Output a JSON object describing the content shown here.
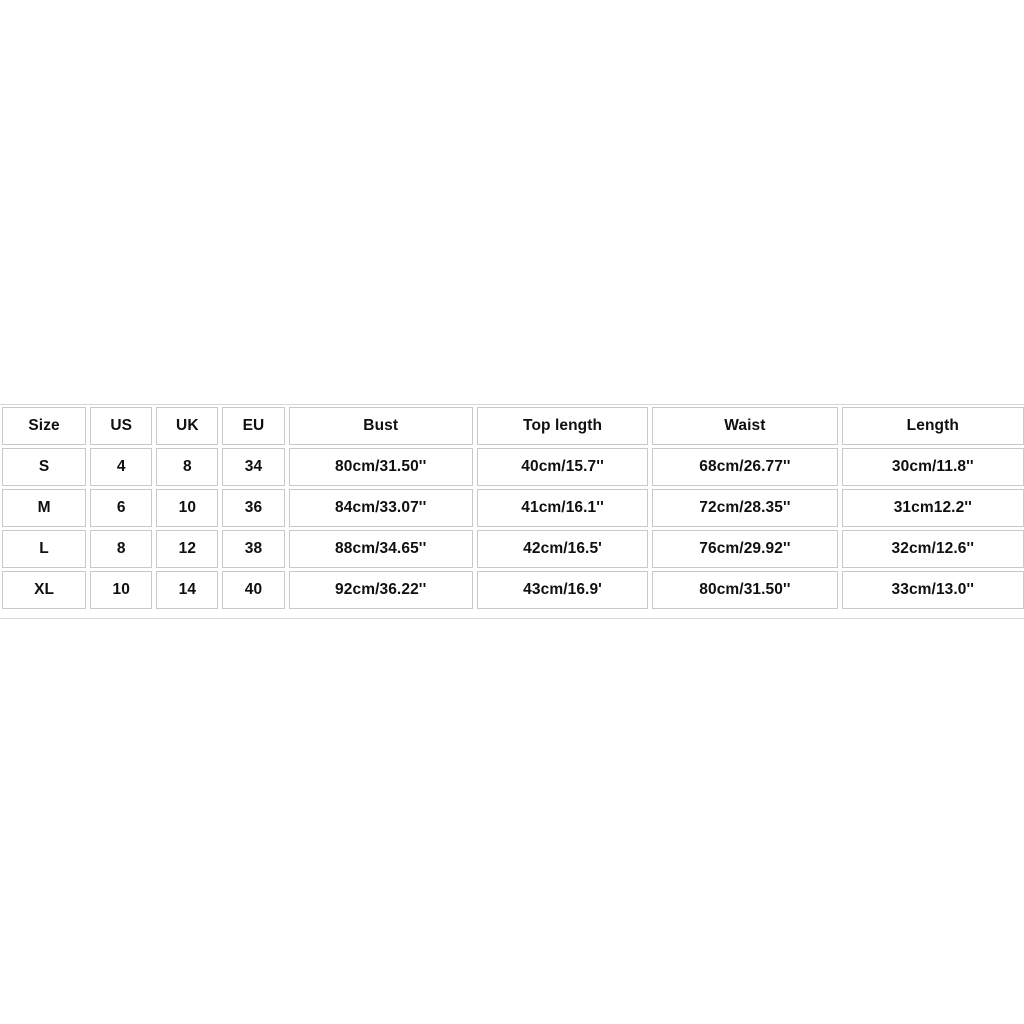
{
  "page": {
    "background_color": "#ffffff",
    "text_color": "#101010",
    "cell_border_color": "#c9c9c9"
  },
  "size_chart": {
    "name": "size-chart",
    "columns": [
      "Size",
      "US",
      "UK",
      "EU",
      "Bust",
      "Top length",
      "Waist",
      "Length"
    ],
    "rows": [
      {
        "size": "S",
        "us": "4",
        "uk": "8",
        "eu": "34",
        "bust": "80cm/31.50''",
        "top_length": "40cm/15.7''",
        "waist": "68cm/26.77''",
        "length": "30cm/11.8''"
      },
      {
        "size": "M",
        "us": "6",
        "uk": "10",
        "eu": "36",
        "bust": "84cm/33.07''",
        "top_length": "41cm/16.1''",
        "waist": "72cm/28.35''",
        "length": "31cm12.2''"
      },
      {
        "size": "L",
        "us": "8",
        "uk": "12",
        "eu": "38",
        "bust": "88cm/34.65''",
        "top_length": "42cm/16.5'",
        "waist": "76cm/29.92''",
        "length": "32cm/12.6''"
      },
      {
        "size": "XL",
        "us": "10",
        "uk": "14",
        "eu": "40",
        "bust": "92cm/36.22''",
        "top_length": "43cm/16.9'",
        "waist": "80cm/31.50''",
        "length": "33cm/13.0''"
      }
    ]
  }
}
